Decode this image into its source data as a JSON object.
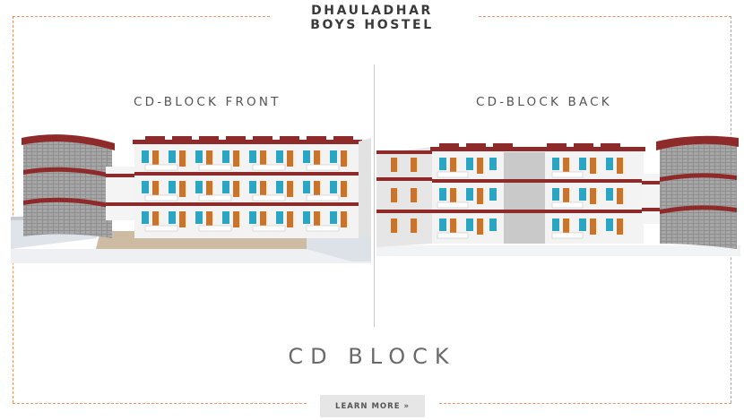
{
  "header": {
    "title_line1": "DHAULADHAR",
    "title_line2": "BOYS HOSTEL"
  },
  "panels": {
    "front_label": "CD-BLOCK FRONT",
    "back_label": "CD-BLOCK BACK"
  },
  "block": {
    "title": "CD BLOCK"
  },
  "cta": {
    "label": "LEARN MORE »"
  },
  "colors": {
    "frame": "#e8956a",
    "roof": "#8e2a2a",
    "window": "#2aa6c4",
    "door": "#c8742e",
    "wall": "#f2f2f2"
  }
}
